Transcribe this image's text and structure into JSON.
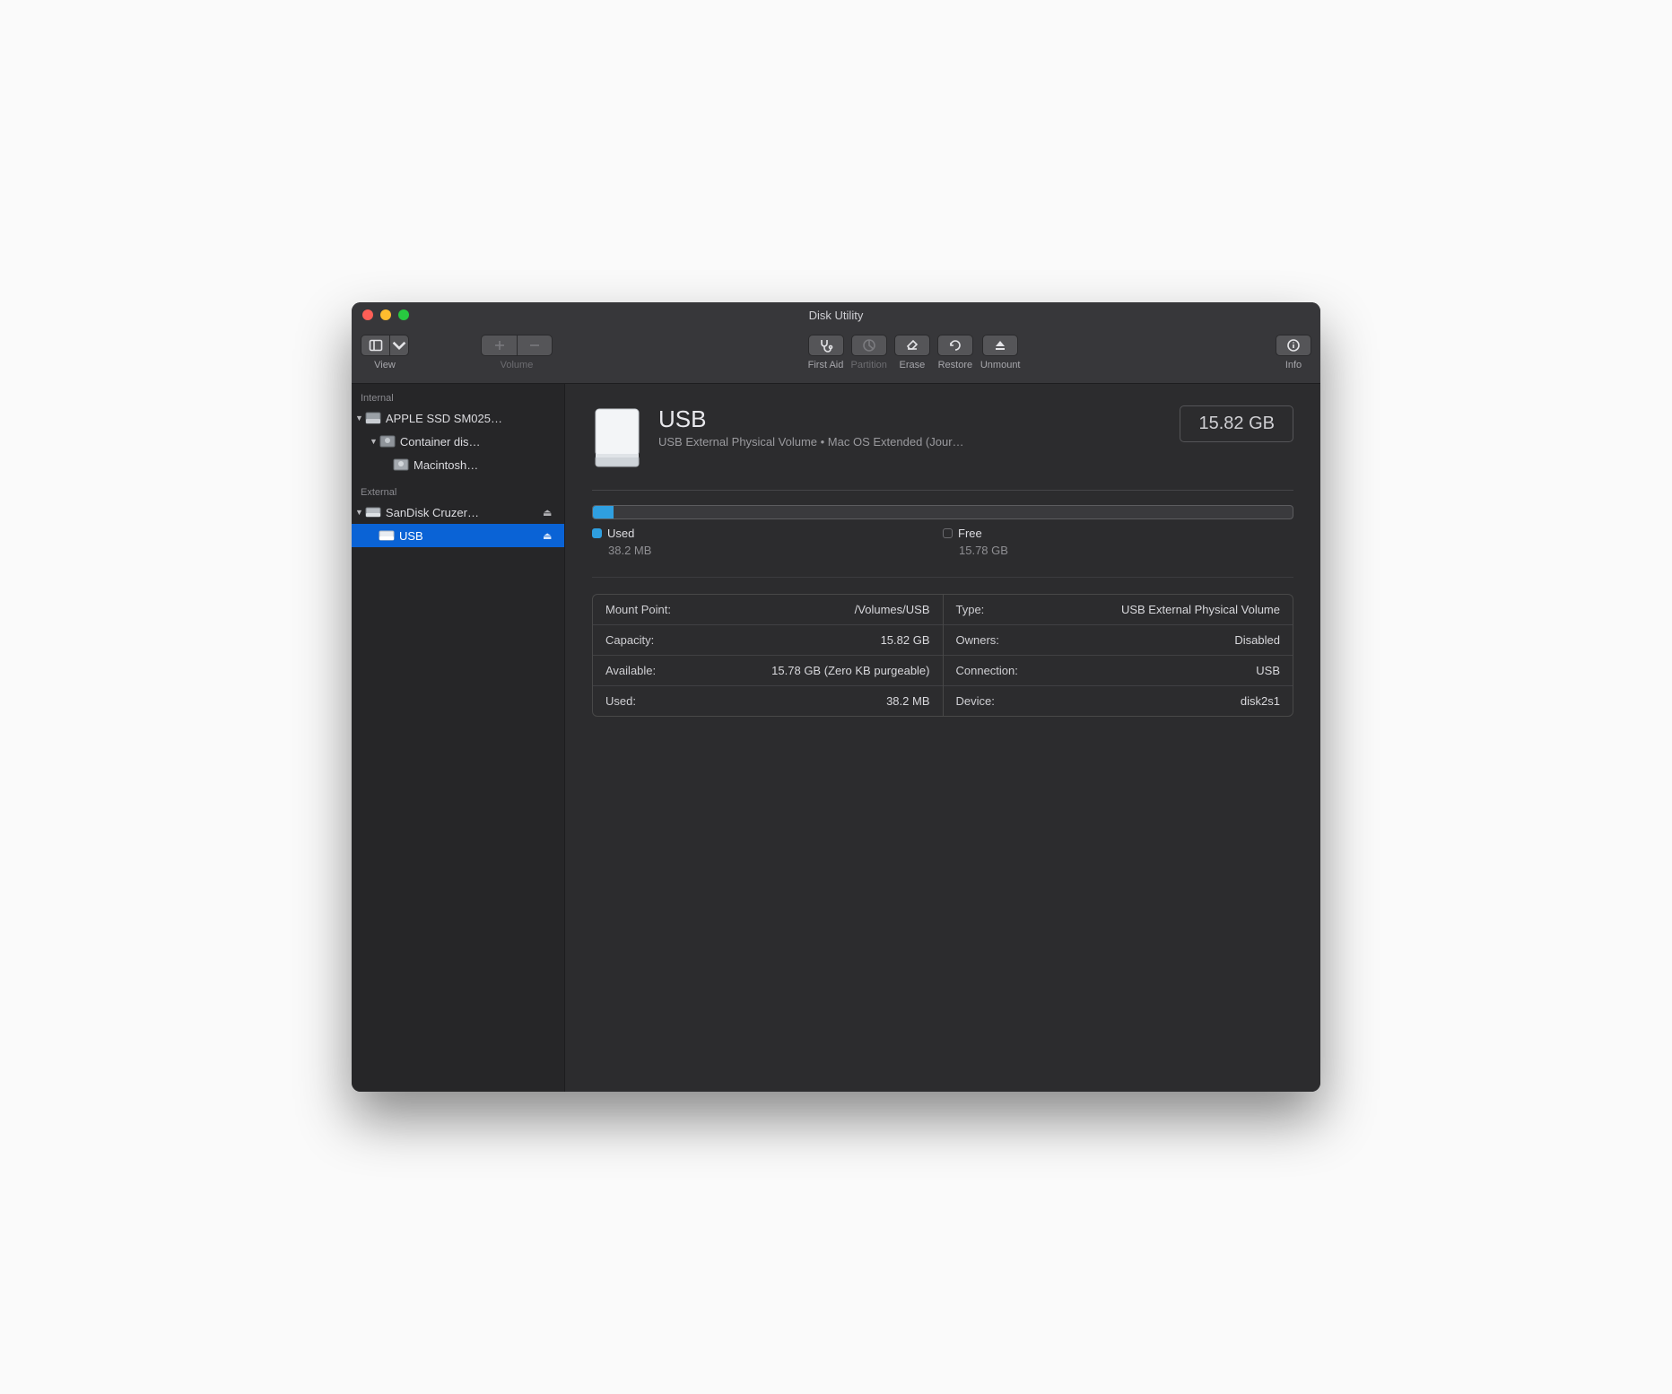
{
  "window": {
    "title": "Disk Utility"
  },
  "toolbar": {
    "view": "View",
    "volume": "Volume",
    "first_aid": "First Aid",
    "partition": "Partition",
    "erase": "Erase",
    "restore": "Restore",
    "unmount": "Unmount",
    "info": "Info"
  },
  "sidebar": {
    "sections": {
      "internal": "Internal",
      "external": "External"
    },
    "internal": [
      {
        "name": "APPLE SSD SM025…",
        "indent": 0,
        "disclosure": true,
        "kind": "ssd"
      },
      {
        "name": "Container dis…",
        "indent": 1,
        "disclosure": true,
        "kind": "container"
      },
      {
        "name": "Macintosh…",
        "indent": 2,
        "disclosure": false,
        "kind": "volume"
      }
    ],
    "external": [
      {
        "name": "SanDisk Cruzer…",
        "indent": 0,
        "disclosure": true,
        "eject": true,
        "kind": "usb-drive"
      },
      {
        "name": "USB",
        "indent": 1,
        "disclosure": false,
        "eject": true,
        "kind": "usb-volume",
        "selected": true
      }
    ]
  },
  "volume": {
    "name": "USB",
    "subtitle": "USB External Physical Volume • Mac OS Extended (Jour…",
    "total_size": "15.82 GB",
    "usage": {
      "used_label": "Used",
      "used_value": "38.2 MB",
      "free_label": "Free",
      "free_value": "15.78 GB",
      "used_fraction_percent": 0.25
    },
    "details_left": [
      {
        "key": "Mount Point:",
        "value": "/Volumes/USB"
      },
      {
        "key": "Capacity:",
        "value": "15.82 GB"
      },
      {
        "key": "Available:",
        "value": "15.78 GB (Zero KB purgeable)"
      },
      {
        "key": "Used:",
        "value": "38.2 MB"
      }
    ],
    "details_right": [
      {
        "key": "Type:",
        "value": "USB External Physical Volume"
      },
      {
        "key": "Owners:",
        "value": "Disabled"
      },
      {
        "key": "Connection:",
        "value": "USB"
      },
      {
        "key": "Device:",
        "value": "disk2s1"
      }
    ]
  }
}
